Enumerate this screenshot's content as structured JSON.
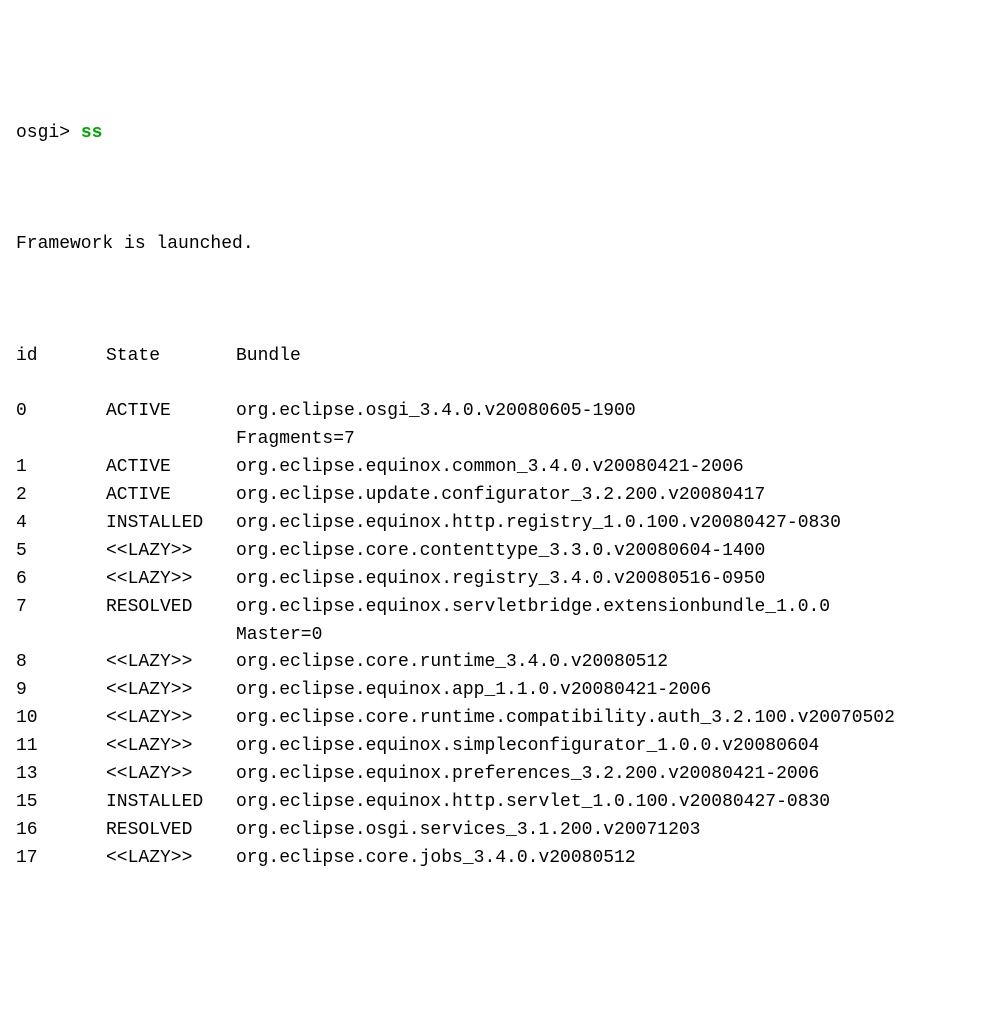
{
  "prompt": "osgi>",
  "command": "ss",
  "status": "Framework is launched.",
  "headers": {
    "id": "id",
    "state": "State",
    "bundle": "Bundle"
  },
  "rows": [
    {
      "id": "0",
      "state": "ACTIVE",
      "bundle": "org.eclipse.osgi_3.4.0.v20080605-1900",
      "extra": "Fragments=7"
    },
    {
      "id": "1",
      "state": "ACTIVE",
      "bundle": "org.eclipse.equinox.common_3.4.0.v20080421-2006"
    },
    {
      "id": "2",
      "state": "ACTIVE",
      "bundle": "org.eclipse.update.configurator_3.2.200.v20080417"
    },
    {
      "id": "4",
      "state": "INSTALLED",
      "bundle": "org.eclipse.equinox.http.registry_1.0.100.v20080427-0830"
    },
    {
      "id": "5",
      "state": "<<LAZY>>",
      "bundle": "org.eclipse.core.contenttype_3.3.0.v20080604-1400"
    },
    {
      "id": "6",
      "state": "<<LAZY>>",
      "bundle": "org.eclipse.equinox.registry_3.4.0.v20080516-0950"
    },
    {
      "id": "7",
      "state": "RESOLVED",
      "bundle": "org.eclipse.equinox.servletbridge.extensionbundle_1.0.0",
      "extra": "Master=0"
    },
    {
      "id": "8",
      "state": "<<LAZY>>",
      "bundle": "org.eclipse.core.runtime_3.4.0.v20080512"
    },
    {
      "id": "9",
      "state": "<<LAZY>>",
      "bundle": "org.eclipse.equinox.app_1.1.0.v20080421-2006"
    },
    {
      "id": "10",
      "state": "<<LAZY>>",
      "bundle": "org.eclipse.core.runtime.compatibility.auth_3.2.100.v20070502"
    },
    {
      "id": "11",
      "state": "<<LAZY>>",
      "bundle": "org.eclipse.equinox.simpleconfigurator_1.0.0.v20080604"
    },
    {
      "id": "13",
      "state": "<<LAZY>>",
      "bundle": "org.eclipse.equinox.preferences_3.2.200.v20080421-2006"
    },
    {
      "id": "15",
      "state": "INSTALLED",
      "bundle": "org.eclipse.equinox.http.servlet_1.0.100.v20080427-0830"
    },
    {
      "id": "16",
      "state": "RESOLVED",
      "bundle": "org.eclipse.osgi.services_3.1.200.v20071203"
    },
    {
      "id": "17",
      "state": "<<LAZY>>",
      "bundle": "org.eclipse.core.jobs_3.4.0.v20080512"
    }
  ]
}
